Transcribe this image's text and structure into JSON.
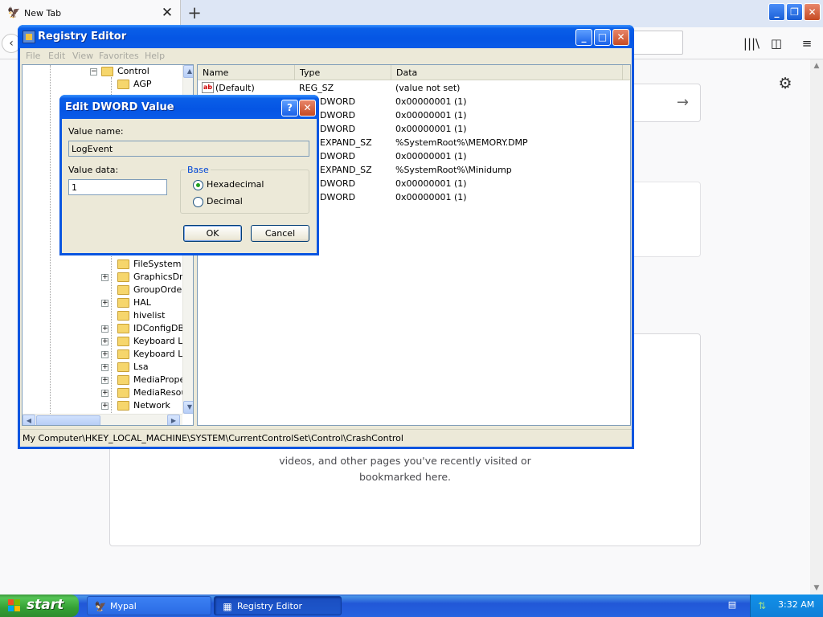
{
  "browser": {
    "tab_title": "New Tab",
    "tab_close_glyph": "✕",
    "new_tab_glyph": "+",
    "highlights_line1": "videos, and other pages you've recently visited or",
    "highlights_line2": "bookmarked here.",
    "icons": [
      "back-arrow-icon",
      "library-icon",
      "sidebar-icon",
      "hamburger-menu-icon",
      "gear-icon",
      "arrow-right-icon"
    ]
  },
  "regedit": {
    "title": "Registry Editor",
    "menu": [
      "File",
      "Edit",
      "View",
      "Favorites",
      "Help"
    ],
    "tree": {
      "parent": "Control",
      "items": [
        "AGP",
        "FileSystem",
        "GraphicsDriv",
        "GroupOrder",
        "HAL",
        "hivelist",
        "IDConfigDB",
        "Keyboard La",
        "Keyboard La",
        "Lsa",
        "MediaProper",
        "MediaResou",
        "Network"
      ]
    },
    "columns": [
      "Name",
      "Type",
      "Data"
    ],
    "rows": [
      {
        "name": "(Default)",
        "type": "REG_SZ",
        "data": "(value not set)"
      },
      {
        "name": "",
        "type": "DWORD",
        "data": "0x00000001 (1)"
      },
      {
        "name": "",
        "type": "DWORD",
        "data": "0x00000001 (1)"
      },
      {
        "name": "",
        "type": "DWORD",
        "data": "0x00000001 (1)"
      },
      {
        "name": "",
        "type": "EXPAND_SZ",
        "data": "%SystemRoot%\\MEMORY.DMP"
      },
      {
        "name": "",
        "type": "DWORD",
        "data": "0x00000001 (1)"
      },
      {
        "name": "",
        "type": "EXPAND_SZ",
        "data": "%SystemRoot%\\Minidump"
      },
      {
        "name": "",
        "type": "DWORD",
        "data": "0x00000001 (1)"
      },
      {
        "name": "",
        "type": "DWORD",
        "data": "0x00000001 (1)"
      }
    ],
    "status": "My Computer\\HKEY_LOCAL_MACHINE\\SYSTEM\\CurrentControlSet\\Control\\CrashControl"
  },
  "dialog": {
    "title": "Edit DWORD Value",
    "value_name_label": "Value name:",
    "value_name": "LogEvent",
    "value_data_label": "Value data:",
    "value_data": "1",
    "base_label": "Base",
    "hex_label": "Hexadecimal",
    "dec_label": "Decimal",
    "selected_base": "Hexadecimal",
    "ok_label": "OK",
    "cancel_label": "Cancel",
    "help_glyph": "?",
    "close_glyph": "✕"
  },
  "taskbar": {
    "start_label": "start",
    "tasks": [
      {
        "label": "Mypal",
        "active": false
      },
      {
        "label": "Registry Editor",
        "active": true
      }
    ],
    "clock": "3:32 AM"
  },
  "colors": {
    "xp_title_blue": "#0a5fe8",
    "start_green": "#34a034",
    "dialog_face": "#ece9d8"
  }
}
